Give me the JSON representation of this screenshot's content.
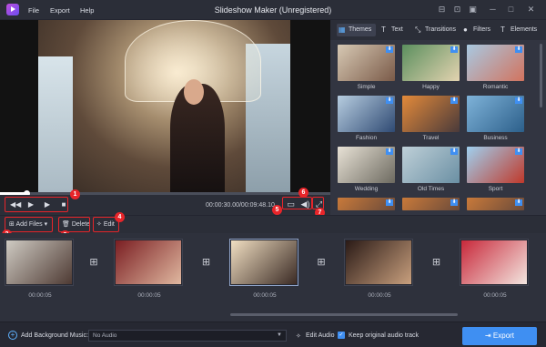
{
  "window": {
    "title": "Slideshow Maker (Unregistered)"
  },
  "menu": [
    "File",
    "Export",
    "Help"
  ],
  "titlebar_icons": [
    "cart-icon",
    "key-icon",
    "chat-icon",
    "minimize-icon",
    "maximize-icon",
    "close-icon"
  ],
  "playback": {
    "timecode": "00:00:30.00/00:09:48.10",
    "progress": 0.08
  },
  "tabs": [
    {
      "label": "Themes",
      "icon": "themes-icon",
      "active": true
    },
    {
      "label": "Text",
      "icon": "text-icon",
      "active": false
    },
    {
      "label": "Transitions",
      "icon": "transitions-icon",
      "active": false
    },
    {
      "label": "Filters",
      "icon": "filters-icon",
      "active": false
    },
    {
      "label": "Elements",
      "icon": "elements-icon",
      "active": false
    }
  ],
  "themes": [
    {
      "name": "Simple",
      "colors": [
        "#d7c9b4",
        "#7a5a48"
      ]
    },
    {
      "name": "Happy",
      "colors": [
        "#5b8f5e",
        "#e3d3b0"
      ]
    },
    {
      "name": "Romantic",
      "colors": [
        "#a8c9e2",
        "#d2735e"
      ]
    },
    {
      "name": "Fashion",
      "colors": [
        "#b7cde0",
        "#2f4a73"
      ]
    },
    {
      "name": "Travel",
      "colors": [
        "#e38a3a",
        "#4a3a3a"
      ]
    },
    {
      "name": "Business",
      "colors": [
        "#7fb3d9",
        "#2c5f8a"
      ]
    },
    {
      "name": "Wedding",
      "colors": [
        "#e8e2d6",
        "#6d6a60"
      ]
    },
    {
      "name": "Old Times",
      "colors": [
        "#bfd0d8",
        "#6a8fa3"
      ]
    },
    {
      "name": "Sport",
      "colors": [
        "#9fd0ef",
        "#c0392b"
      ]
    }
  ],
  "edit_toolbar": {
    "add_files": "Add Files",
    "delete": "Delete",
    "edit": "Edit"
  },
  "badges": [
    "1",
    "2",
    "3",
    "4",
    "5",
    "6",
    "7"
  ],
  "timeline": {
    "clips": [
      {
        "duration": "00:00:05",
        "colors": [
          "#cfcbc3",
          "#4e3a33"
        ],
        "selected": false
      },
      {
        "duration": "00:00:05",
        "colors": [
          "#7a1e22",
          "#e0b8a0"
        ],
        "selected": false
      },
      {
        "duration": "00:00:05",
        "colors": [
          "#f1dfc2",
          "#3a2a24"
        ],
        "selected": true
      },
      {
        "duration": "00:00:05",
        "colors": [
          "#2a1a16",
          "#c9a07e"
        ],
        "selected": false
      },
      {
        "duration": "00:00:05",
        "colors": [
          "#c8283a",
          "#f3e6e0"
        ],
        "selected": false
      }
    ]
  },
  "bottom_bar": {
    "add_music_label": "Add Background Music:",
    "audio_value": "No Audio",
    "edit_audio": "Edit Audio",
    "keep_audio": "Keep original audio track",
    "export": "Export"
  },
  "colors": {
    "accent": "#3f8ff2",
    "callout": "#e8252a"
  }
}
